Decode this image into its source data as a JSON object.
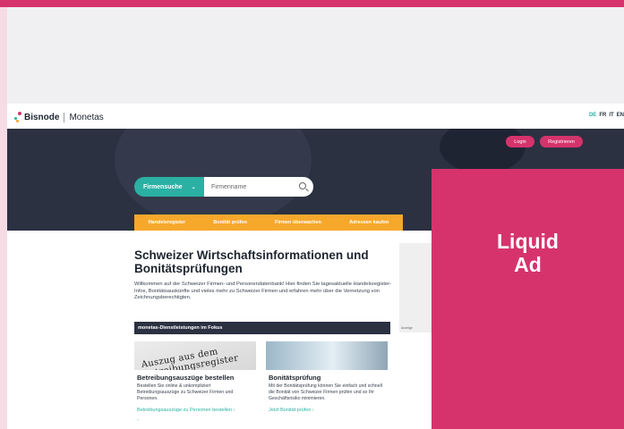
{
  "header": {
    "logo_bisnode": "Bisnode",
    "logo_monetas": "Monetas",
    "languages": [
      "DE",
      "FR",
      "IT",
      "EN"
    ]
  },
  "hero": {
    "login": "Login",
    "register": "Registrieren",
    "search_category": "Firmensuche",
    "search_placeholder": "Firmenname"
  },
  "nav": {
    "items": [
      "Handelsregister",
      "Bonität prüfen",
      "Firmen überwachen",
      "Adressen kaufen"
    ]
  },
  "content": {
    "title": "Schweizer Wirtschaftsinformationen und Bonitätsprüfungen",
    "intro": "Willkommen auf der Schweizer Firmen- und Personendatenbank! Hier finden Sie tagesaktuelle Handelsregister-Infos, Bonitätsauskünfte und vieles mehr zu Schweizer Firmen und erfahren mehr über die Vernetzung von Zeichnungsberechtigten.",
    "focus_title": "monetas-Dienstleistungen im Fokus"
  },
  "cards": [
    {
      "image_text": "Auszug aus dem Betreibungsregister",
      "title": "Betreibungsauszüge bestellen",
      "text": "Bestellen Sie online & unkompliziert Betreibungsauszüge zu Schweizer Firmen und Personen.",
      "link": "Betreibungsauszüge zu Personen bestellen"
    },
    {
      "title": "Bonitätsprüfung",
      "text": "Mit der Bonitätsprüfung können Sie einfach und schnell die Bonität von Schweizer Firmen prüfen und so Ihr Geschäftsrisiko minimieren.",
      "link": "Jetzt Bonität prüfen"
    }
  ],
  "ad": {
    "label": "Anzeige",
    "liquid_line1": "Liquid",
    "liquid_line2": "Ad"
  },
  "colors": {
    "pink": "#d6336c",
    "teal": "#2bb0a4",
    "orange": "#f6a82b",
    "navy": "#2b3141"
  }
}
